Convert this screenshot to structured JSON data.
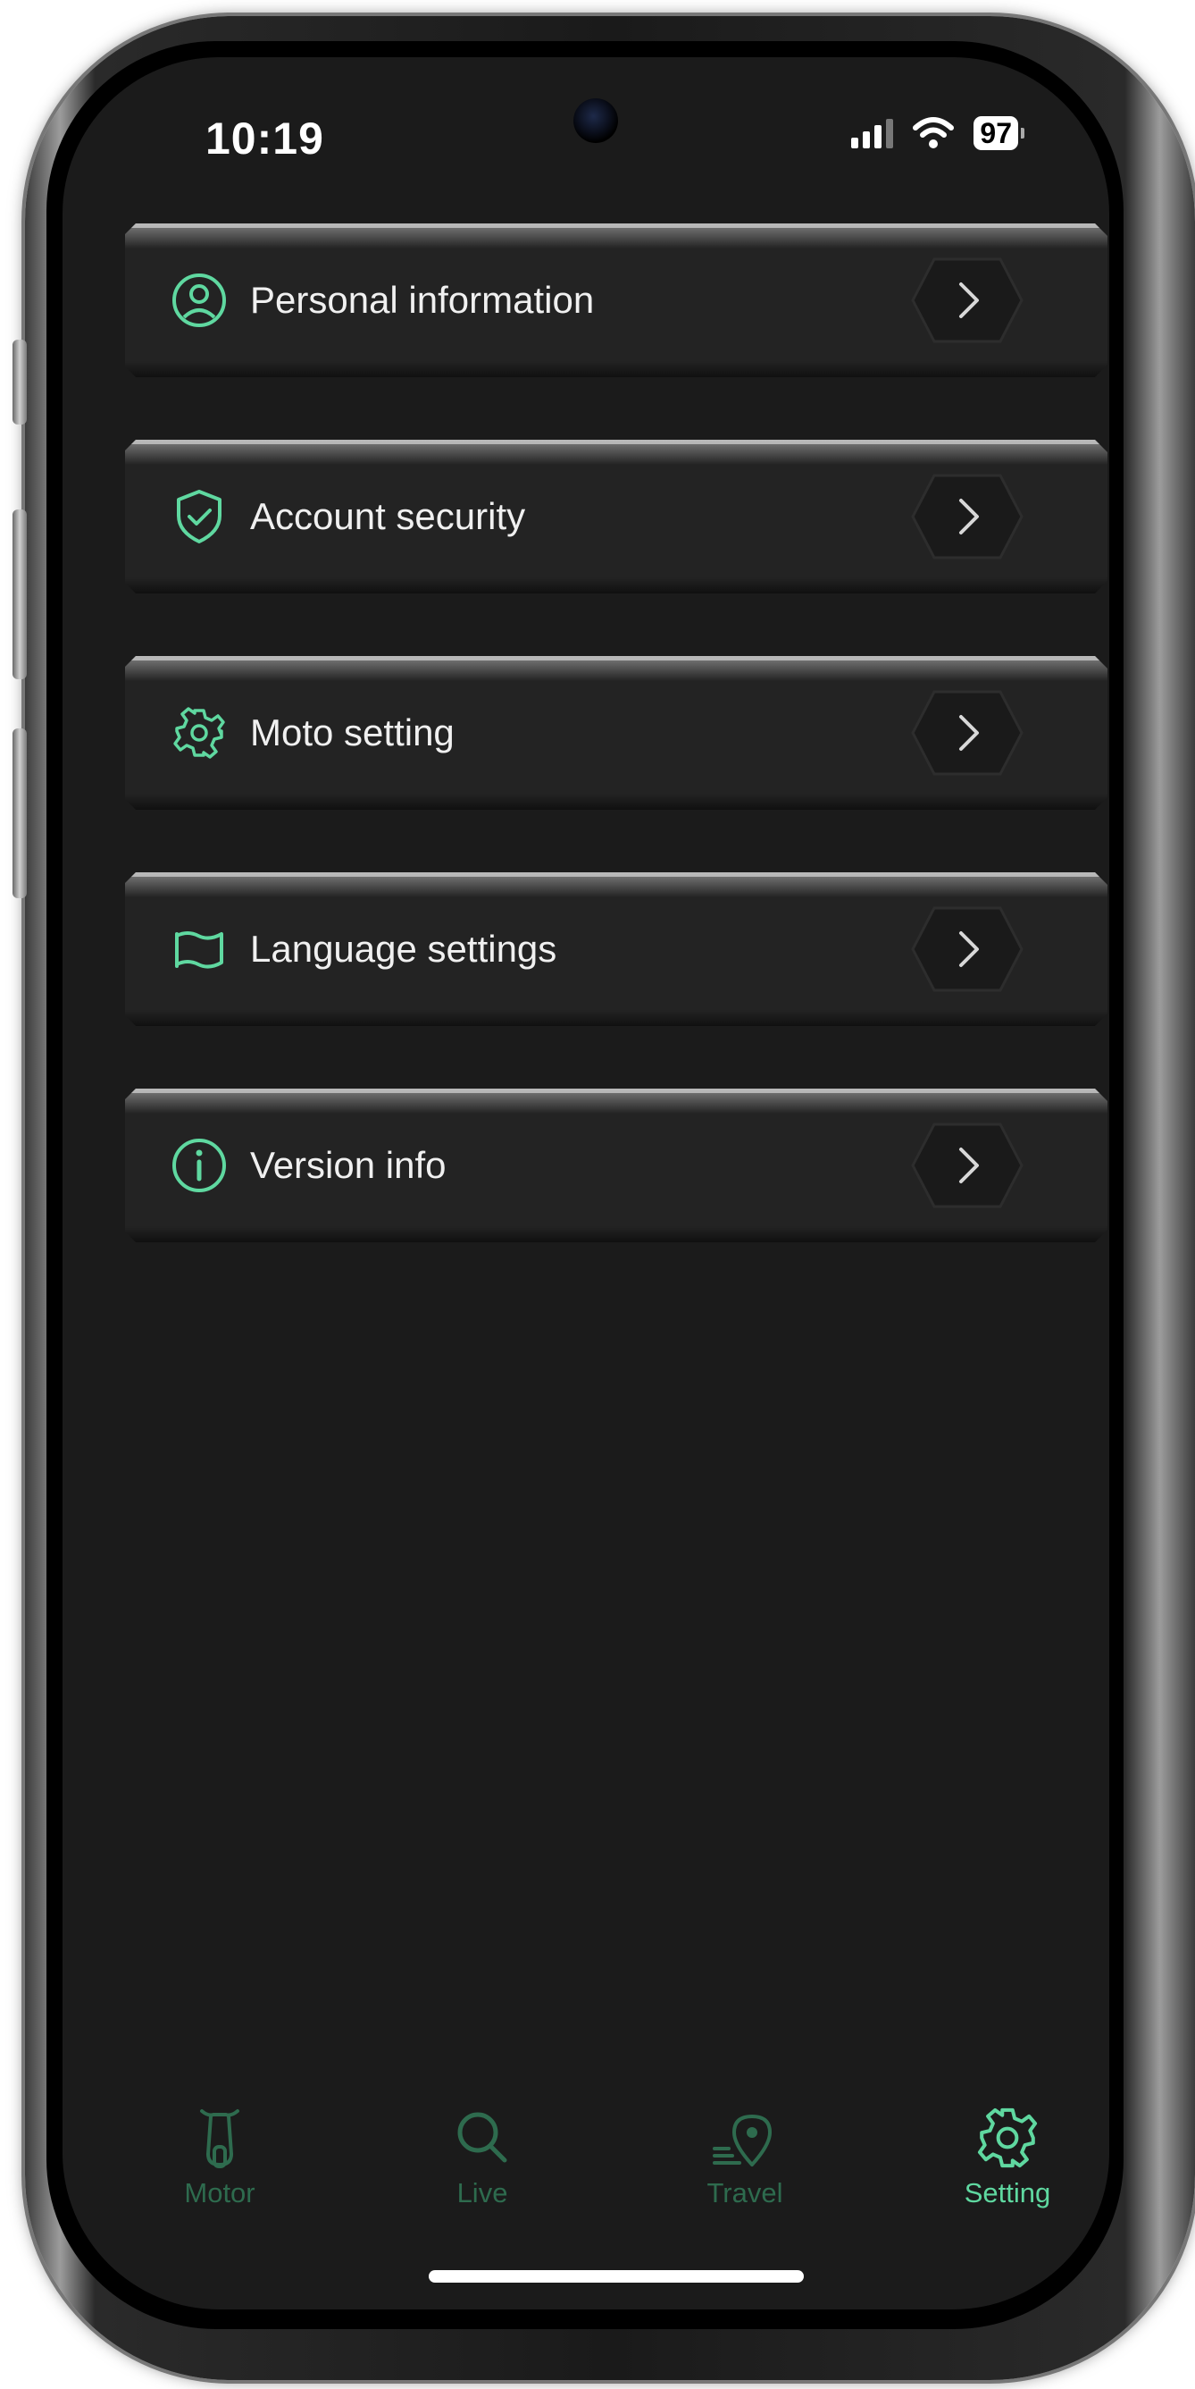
{
  "status_bar": {
    "time": "10:19",
    "battery": "97"
  },
  "menu": {
    "items": [
      {
        "label": "Personal information",
        "icon": "person-circle-icon"
      },
      {
        "label": "Account security",
        "icon": "shield-check-icon"
      },
      {
        "label": "Moto setting",
        "icon": "gear-icon"
      },
      {
        "label": "Language settings",
        "icon": "flag-icon"
      },
      {
        "label": "Version info",
        "icon": "info-circle-icon"
      }
    ]
  },
  "tab_bar": {
    "tabs": [
      {
        "label": "Motor",
        "icon": "scooter-icon",
        "active": false
      },
      {
        "label": "Live",
        "icon": "search-icon",
        "active": false
      },
      {
        "label": "Travel",
        "icon": "location-pin-icon",
        "active": false
      },
      {
        "label": "Setting",
        "icon": "gear-icon",
        "active": true
      }
    ]
  },
  "colors": {
    "accent": "#5fd8a0",
    "inactive_tab": "#2e6b4e",
    "background": "#1b1b1b",
    "card": "#232323"
  }
}
